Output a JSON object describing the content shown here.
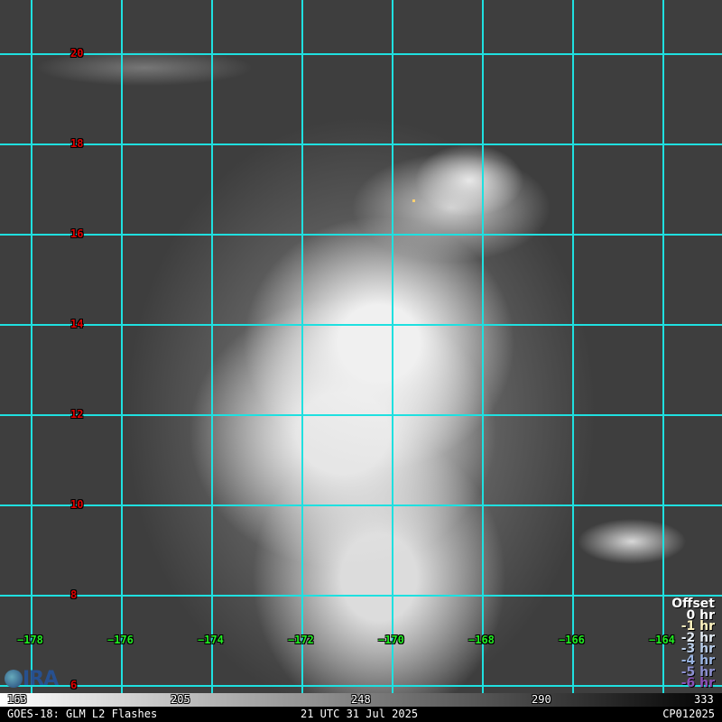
{
  "grid": {
    "latitudes": [
      "20",
      "18",
      "16",
      "14",
      "12",
      "10",
      "8",
      "6"
    ],
    "longitudes": [
      "−178",
      "−176",
      "−174",
      "−172",
      "−170",
      "−168",
      "−166",
      "−164"
    ],
    "line_color": "#1fe0e0"
  },
  "legend": {
    "title": "Offset",
    "items": [
      {
        "label": "0 hr",
        "color": "#ffffff"
      },
      {
        "label": "-1 hr",
        "color": "#fff4c0"
      },
      {
        "label": "-2 hr",
        "color": "#e0e8f0"
      },
      {
        "label": "-3 hr",
        "color": "#b8cce8"
      },
      {
        "label": "-4 hr",
        "color": "#9ab4e0"
      },
      {
        "label": "-5 hr",
        "color": "#8c90d0"
      },
      {
        "label": "-6 hr",
        "color": "#8a50b8"
      }
    ]
  },
  "logo": "CIRA",
  "colorbar": {
    "ticks": [
      "163",
      "205",
      "248",
      "290",
      "333"
    ]
  },
  "footer": {
    "left": "GOES-18: GLM L2 Flashes",
    "center": "21 UTC 31 Jul 2025",
    "right": "CP012025"
  }
}
